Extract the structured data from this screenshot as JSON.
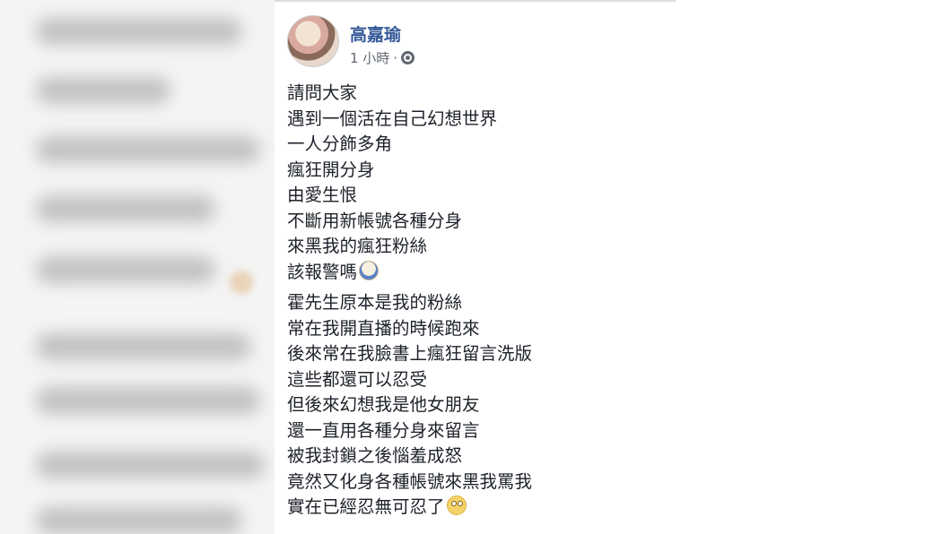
{
  "post": {
    "author": "高嘉瑜",
    "time": "1 小時",
    "separator": "·",
    "paragraphs": [
      {
        "lines": [
          {
            "text": "請問大家"
          },
          {
            "text": "遇到一個活在自己幻想世界"
          },
          {
            "text": "一人分飾多角"
          },
          {
            "text": "瘋狂開分身"
          },
          {
            "text": "由愛生恨"
          },
          {
            "text": "不斷用新帳號各種分身"
          },
          {
            "text": "來黑我的瘋狂粉絲"
          },
          {
            "text": "該報警嗎",
            "emoji": "face-screaming-in-fear-emoji"
          }
        ]
      },
      {
        "lines": [
          {
            "text": "霍先生原本是我的粉絲"
          },
          {
            "text": "常在我開直播的時候跑來"
          },
          {
            "text": "後來常在我臉書上瘋狂留言洗版"
          },
          {
            "text": "這些都還可以忍受"
          },
          {
            "text": "但後來幻想我是他女朋友"
          },
          {
            "text": "還一直用各種分身來留言"
          },
          {
            "text": "被我封鎖之後惱羞成怒"
          },
          {
            "text": "竟然又化身各種帳號來黑我罵我"
          },
          {
            "text": "實在已經忍無可忍了",
            "emoji": "face-with-rolling-eyes-emoji"
          }
        ]
      }
    ]
  },
  "colors": {
    "author_link": "#365899",
    "meta_text": "#616770",
    "body_text": "#1d2129"
  }
}
